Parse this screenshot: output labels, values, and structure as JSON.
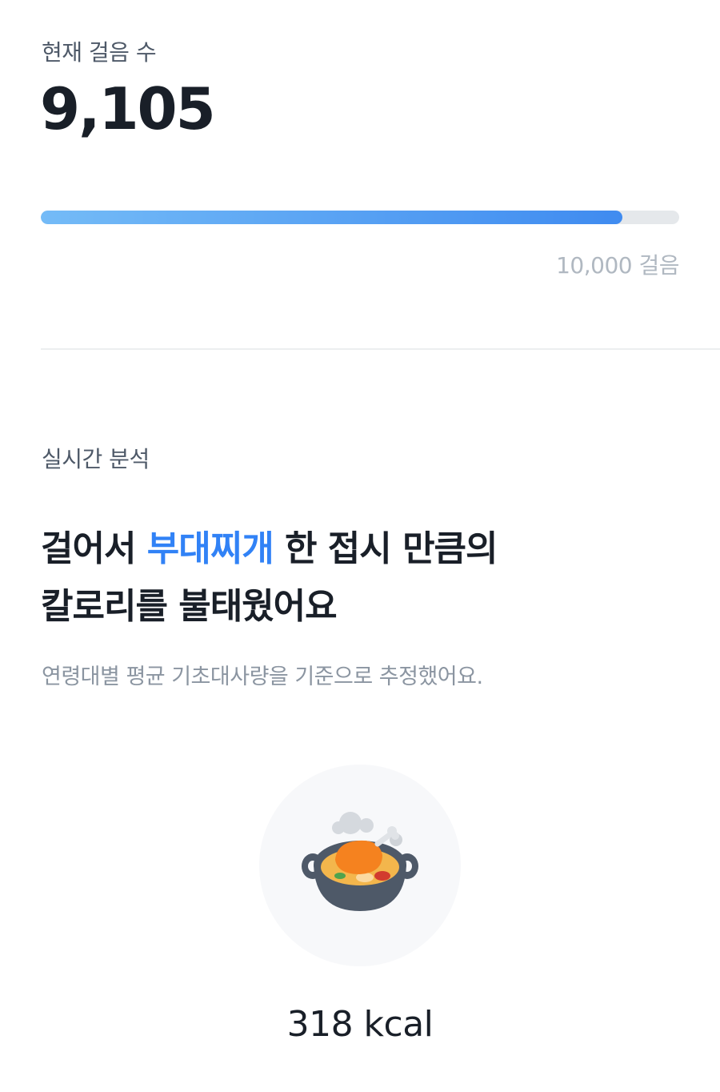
{
  "steps": {
    "label": "현재 걸음 수",
    "count": "9,105",
    "progress_fraction": 0.9105,
    "goal_label": "10,000 걸음"
  },
  "analysis": {
    "section_label": "실시간 분석",
    "headline_before": "걸어서 ",
    "headline_food": "부대찌개",
    "headline_after_line1": " 한 접시 만큼의",
    "headline_line2": "칼로리를 불태웠어요",
    "description": "연령대별 평균 기초대사량을 기준으로 추정했어요.",
    "food_icon": "stew-pot-icon",
    "calories": "318 kcal"
  },
  "colors": {
    "accent": "#3182f6",
    "progress_start": "#74bbf7",
    "progress_end": "#3f8bf0",
    "track": "#e5e8eb"
  }
}
